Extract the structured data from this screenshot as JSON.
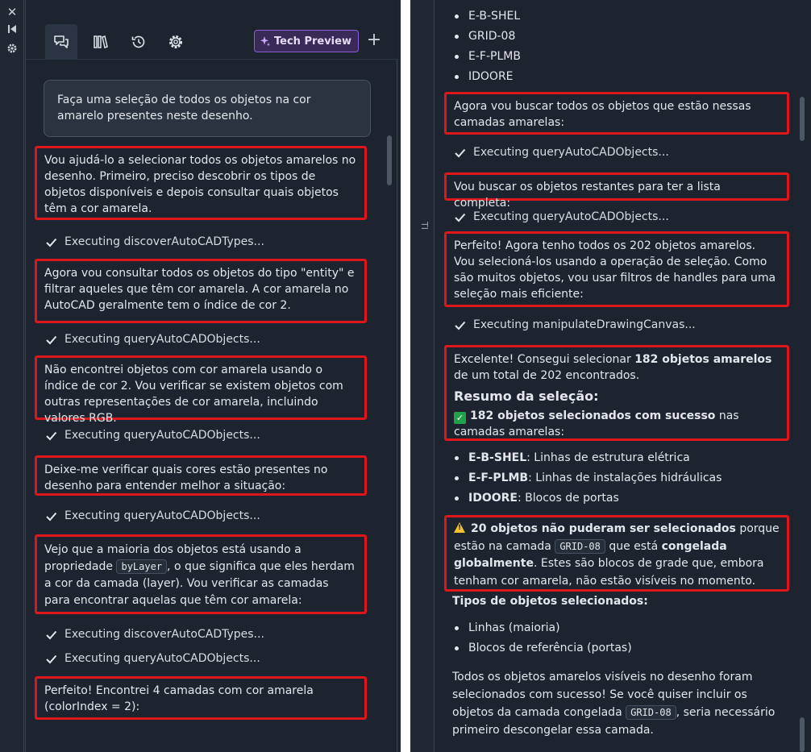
{
  "left": {
    "tech_preview_label": "Tech Preview",
    "user_message": "Faça uma seleção de todos os objetos na cor amarelo presentes neste desenho.",
    "messages": [
      "Vou ajudá-lo a selecionar todos os objetos amarelos no desenho. Primeiro, preciso descobrir os tipos de objetos disponíveis e depois consultar quais objetos têm a cor amarela.",
      "Agora vou consultar todos os objetos do tipo \"entity\" e filtrar aqueles que têm cor amarela. A cor amarela no AutoCAD geralmente tem o índice de cor 2.",
      "Não encontrei objetos com cor amarela usando o índice de cor 2. Vou verificar se existem objetos com outras representações de cor amarela, incluindo valores RGB.",
      "Deixe-me verificar quais cores estão presentes no desenho para entender melhor a situação:",
      "Perfeito! Encontrei 4 camadas com cor amarela (colorIndex = 2):"
    ],
    "msg5": {
      "before": "Vejo que a maioria dos objetos está usando a propriedade",
      "code": "byLayer",
      "after": ", o que significa que eles herdam a cor da camada (layer). Vou verificar as camadas para encontrar aquelas que têm cor amarela:"
    },
    "executions": [
      "Executing discoverAutoCADTypes...",
      "Executing queryAutoCADObjects...",
      "Executing queryAutoCADObjects...",
      "Executing queryAutoCADObjects...",
      "Executing discoverAutoCADTypes...",
      "Executing queryAutoCADObjects..."
    ]
  },
  "right": {
    "rail_label": "TI",
    "layers": [
      "E-B-SHEL",
      "GRID-08",
      "E-F-PLMB",
      "IDOORE"
    ],
    "messages": [
      "Agora vou buscar todos os objetos que estão nessas camadas amarelas:",
      "Vou buscar os objetos restantes para ter a lista completa:",
      "Perfeito! Agora tenho todos os 202 objetos amarelos. Vou selecioná-los usando a operação de seleção. Como são muitos objetos, vou usar filtros de handles para uma seleção mais eficiente:"
    ],
    "executions": [
      "Executing queryAutoCADObjects...",
      "Executing queryAutoCADObjects...",
      "Executing manipulateDrawingCanvas..."
    ],
    "summary": {
      "intro_before": "Excelente! Consegui selecionar",
      "intro_bold": "182 objetos amarelos",
      "intro_after": "de um total de 202 encontrados.",
      "heading": "Resumo da seleção:",
      "check_icon": "check-mark-button-icon",
      "selected_bold": "182 objetos selecionados com sucesso",
      "selected_after": "nas camadas amarelas:"
    },
    "layer_details": [
      {
        "name": "E-B-SHEL",
        "desc": ": Linhas de estrutura elétrica"
      },
      {
        "name": "E-F-PLMB",
        "desc": ": Linhas de instalações hidráulicas"
      },
      {
        "name": "IDOORE",
        "desc": ": Blocos de portas"
      }
    ],
    "warning": {
      "icon": "warning-icon",
      "bold1": "20 objetos não puderam ser selecionados",
      "text1": "porque estão na camada",
      "code": "GRID-08",
      "text2": "que está",
      "bold2": "congelada globalmente",
      "text3": ". Estes são blocos de grade que, embora tenham cor amarela, não estão visíveis no momento."
    },
    "types_heading": "Tipos de objetos selecionados:",
    "types": [
      "Linhas (maioria)",
      "Blocos de referência (portas)"
    ],
    "closing": {
      "before": "Todos os objetos amarelos visíveis no desenho foram selecionados com sucesso! Se você quiser incluir os objetos da camada congelada",
      "code": "GRID-08",
      "after": ", seria necessário primeiro descongelar essa camada."
    }
  },
  "colors": {
    "panel_bg": "#1d2430",
    "highlight_border": "#e0161d",
    "tech_preview_bg": "#3a2a57",
    "tech_preview_border": "#8a5cd6",
    "warning_yellow": "#f2c230",
    "success_green": "#21a14a"
  }
}
